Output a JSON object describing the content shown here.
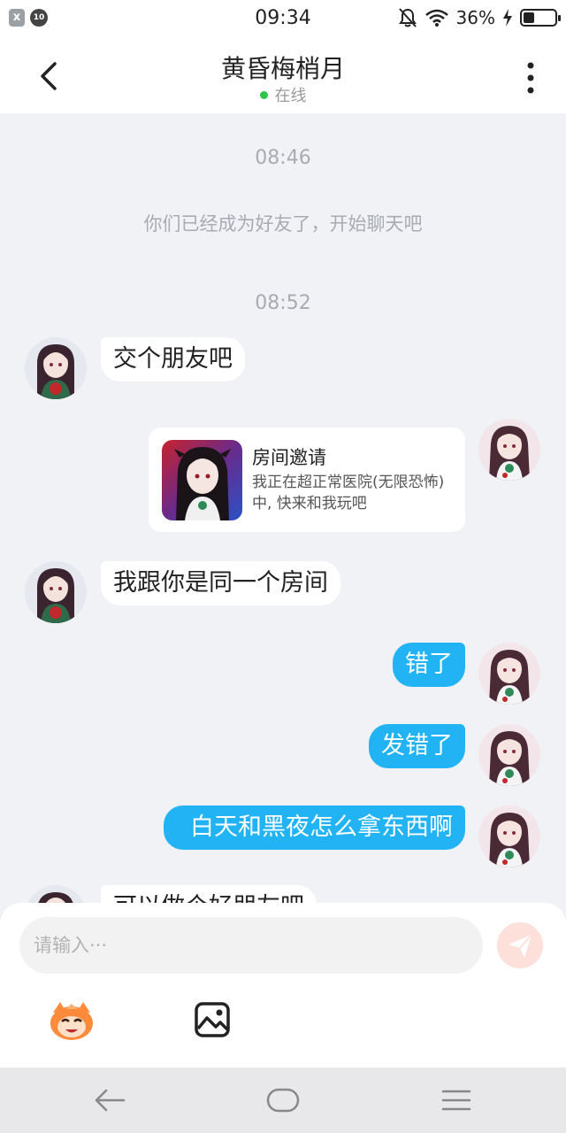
{
  "status_bar": {
    "time": "09:34",
    "left_icon_glyph": "x",
    "notification_badge": "10",
    "battery_text": "36%",
    "battery_level": 0.36
  },
  "header": {
    "title": "黄昏梅梢月",
    "status": "在线"
  },
  "messages": {
    "time_1": "08:46",
    "system_text": "你们已经成为好友了，开始聊天吧",
    "time_2": "08:52",
    "m1": "交个朋友吧",
    "invite_title": "房间邀请",
    "invite_desc": "我正在超正常医院(无限恐怖)中, 快来和我玩吧",
    "m2": "我跟你是同一个房间",
    "m3": "错了",
    "m4": "发错了",
    "m5": "白天和黑夜怎么拿东西啊",
    "m6_partial": "可以做个好朋友吧"
  },
  "input": {
    "placeholder": "请输入···"
  },
  "icons": {
    "back": "chevron-left-icon",
    "more": "more-vertical-icon",
    "send": "send-icon",
    "emoji": "mascot-emoji-icon",
    "image": "image-icon"
  },
  "colors": {
    "accent_bubble": "#22b3f4",
    "online_dot": "#2dc54c",
    "background": "#f1f2f6",
    "send_button_disabled": "#fde0da"
  }
}
